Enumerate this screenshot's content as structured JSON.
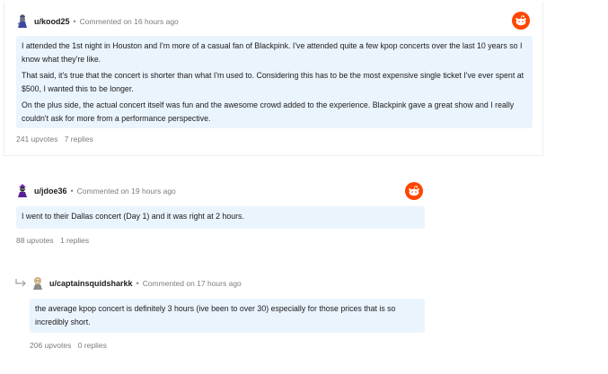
{
  "comments": [
    {
      "username": "u/kood25",
      "separator": "•",
      "time": "Commented on 16 hours ago",
      "paragraphs": [
        "I attended the 1st night in Houston and I'm more of a casual fan of Blackpink. I've attended quite a few kpop concerts over the last 10 years so I know what they're like.",
        "That said, it's true that the concert is shorter than what I'm used to. Considering this has to be the most expensive single ticket I've ever spent at $500, I wanted this to be longer.",
        "On the plus side, the actual concert itself was fun and the awesome crowd added to the experience. Blackpink gave a great show and I really couldn't ask for more from a performance perspective."
      ],
      "upvotes": "241 upvotes",
      "replies": "7 replies"
    },
    {
      "username": "u/jdoe36",
      "separator": "•",
      "time": "Commented on 19 hours ago",
      "paragraphs": [
        "I went to their Dallas concert (Day 1) and it was right at 2 hours."
      ],
      "upvotes": "88 upvotes",
      "replies": "1 replies"
    },
    {
      "username": "u/captainsquidsharkk",
      "separator": "•",
      "time": "Commented on 17 hours ago",
      "paragraphs": [
        "the average kpop concert is definitely 3 hours (ive been to over 30) especially for those prices that is so incredibly short."
      ],
      "upvotes": "206 upvotes",
      "replies": "0 replies"
    }
  ],
  "colors": {
    "bubble": "#eaf4fd",
    "reddit_orange": "#ff4500",
    "muted": "#7c7c7c"
  }
}
